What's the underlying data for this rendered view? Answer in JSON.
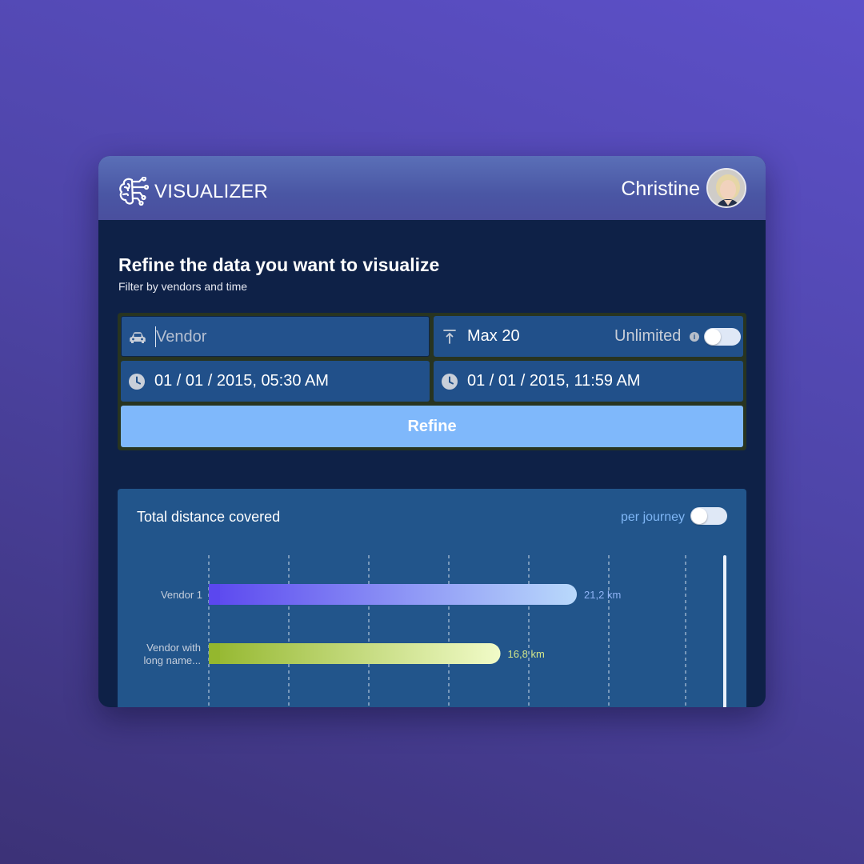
{
  "header": {
    "app_title": "VISUALIZER",
    "logo_icon": "brain-circuit-icon",
    "user_name": "Christine"
  },
  "filters": {
    "heading": "Refine the data you want to visualize",
    "subheading": "Filter by vendors and time",
    "vendor_placeholder": "Vendor",
    "vendor_value": "",
    "max_label": "Max 20",
    "unlimited_label": "Unlimited",
    "unlimited_on": false,
    "from_datetime": "01 / 01 / 2015, 05:30 AM",
    "to_datetime": "01 / 01 / 2015, 11:59 AM",
    "refine_label": "Refine",
    "icons": {
      "vendor": "car-icon",
      "max": "arrow-up-bar-icon",
      "from": "clock-icon",
      "to": "clock-icon",
      "info": "info-icon"
    }
  },
  "chart": {
    "title": "Total distance covered",
    "per_journey_label": "per journey",
    "per_journey_on": false,
    "colors": {
      "vendor1_start": "#5b47ef",
      "vendor1_end": "#b9d9fb",
      "vendor2_start": "#94b72e",
      "vendor2_end": "#f1fbc8",
      "vendor1_value_text": "#8fb3f5",
      "vendor2_value_text": "#d2e58a"
    }
  },
  "chart_data": {
    "type": "bar",
    "orientation": "horizontal",
    "categories": [
      "Vendor 1",
      "Vendor with long name..."
    ],
    "values": [
      21.2,
      16.8
    ],
    "value_labels": [
      "21,2 km",
      "16,8 km"
    ],
    "unit": "km",
    "xlim": [
      0,
      30
    ],
    "grid": true
  }
}
